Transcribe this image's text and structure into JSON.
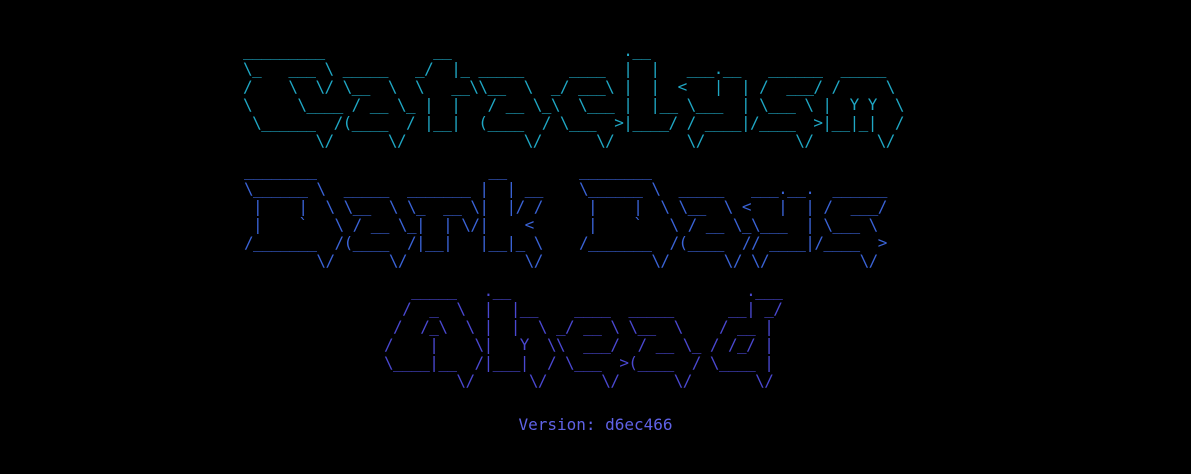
{
  "title_art": {
    "line1": " _________            __                   .__                               \n \\_   ___ \\ _____   _/  |_ _____     ____  |  |   ___.__   ______  _____  \n /    \\  \\/ \\__  \\  \\   __\\\\__  \\  _/ ___\\ |  |  <   |  | /  ___/ /     \\ \n \\     \\____ / __ \\_ |  |   / __ \\_\\  \\___ |  |__ \\___  | \\___ \\ |  Y Y  \\\n  \\______  /(____  / |__|  (____  / \\___  >|____/ / ____|/____  >|__|_|  /\n         \\/      \\/             \\/      \\/        \\/          \\/       \\/ ",
    "line2": "________                   __        ________                            \n\\______ \\  _____  _______ |  | __    \\______ \\  _____   ___.__.  ______\n |    |  \\ \\__  \\ \\_  __ \\|  |/ /     |    |  \\ \\__  \\ <   |  | /  ___/\n |    `   \\ / __ \\_|  | \\/|    <      |    `   \\ / __ \\_\\___  | \\___ \\ \n/_______  /(____  /|__|   |__|_ \\    /_______  /(____  // ____|/____  >\n        \\/      \\/             \\/            \\/      \\/ \\/          \\/ ",
    "line3": "   _____   .__                          .___\n  /  _  \\  |  |__    ____  _____      __| _/\n /  /_\\  \\ |  |  \\ _/ __ \\ \\__  \\    / __ | \n/    |    \\|   Y  \\\\  ___/  / __ \\_ / /_/ | \n\\____|__  /|___|  / \\___  >(____  / \\____ | \n        \\/      \\/      \\/      \\/       \\/ "
  },
  "version": {
    "label": "Version:",
    "value": "d6ec466",
    "text": "Version: d6ec466"
  },
  "colors": {
    "background": "#000000",
    "line1": "#1fa7c4",
    "line2": "#3a63d6",
    "line3": "#4a48d0",
    "version": "#5f62e6"
  }
}
